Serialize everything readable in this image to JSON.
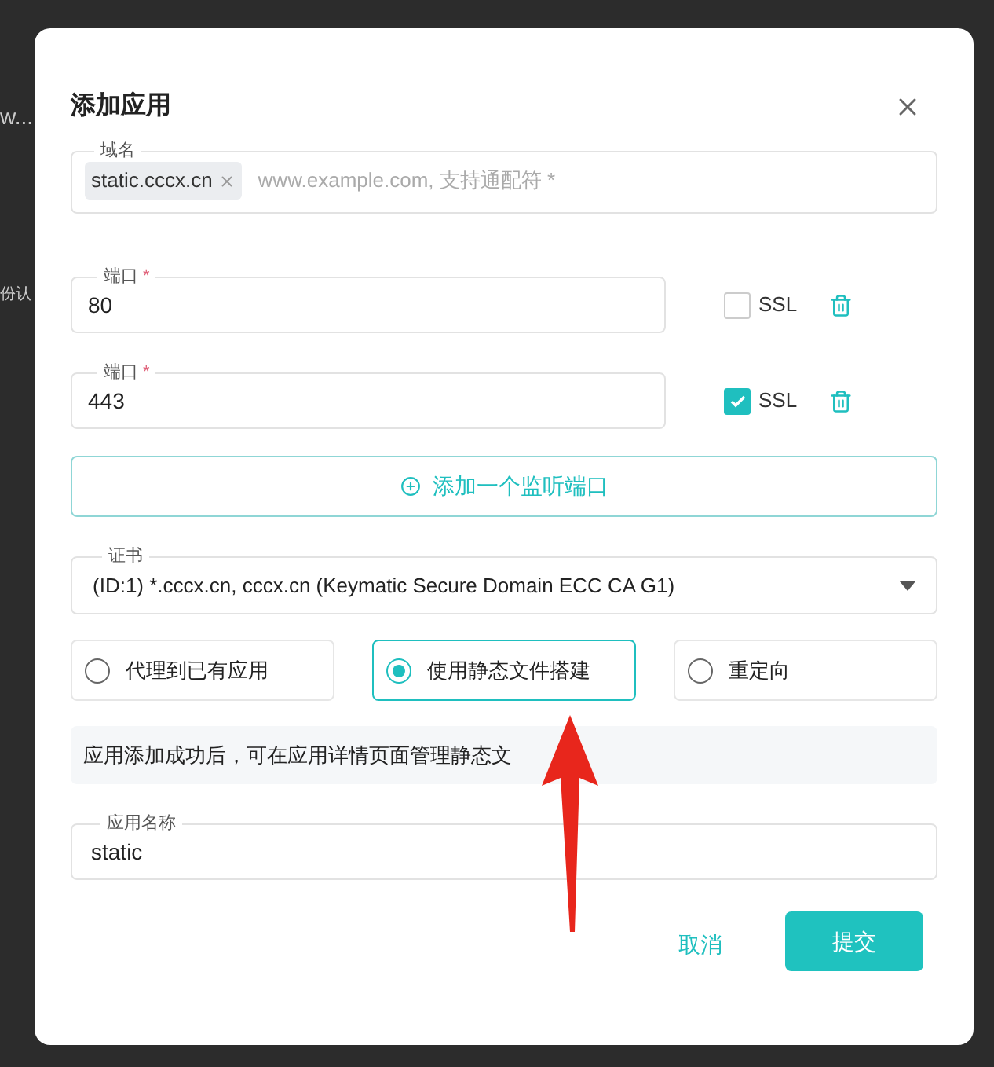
{
  "background": {
    "snippets": [
      "w...",
      "份认"
    ]
  },
  "dialog": {
    "title": "添加应用",
    "domain": {
      "label": "域名",
      "tags": [
        "static.cccx.cn"
      ],
      "placeholder": "www.example.com, 支持通配符 *"
    },
    "ports": [
      {
        "label": "端口",
        "required_mark": "*",
        "value": "80",
        "ssl_label": "SSL",
        "ssl_checked": false
      },
      {
        "label": "端口",
        "required_mark": "*",
        "value": "443",
        "ssl_label": "SSL",
        "ssl_checked": true
      }
    ],
    "add_port": "添加一个监听端口",
    "certificate": {
      "label": "证书",
      "value": "(ID:1) *.cccx.cn, cccx.cn (Keymatic Secure Domain ECC CA G1)"
    },
    "modes": [
      {
        "label": "代理到已有应用",
        "selected": false
      },
      {
        "label": "使用静态文件搭建",
        "selected": true
      },
      {
        "label": "重定向",
        "selected": false
      }
    ],
    "info": "应用添加成功后，可在应用详情页面管理静态文",
    "app_name": {
      "label": "应用名称",
      "value": "static"
    },
    "buttons": {
      "cancel": "取消",
      "submit": "提交"
    }
  }
}
